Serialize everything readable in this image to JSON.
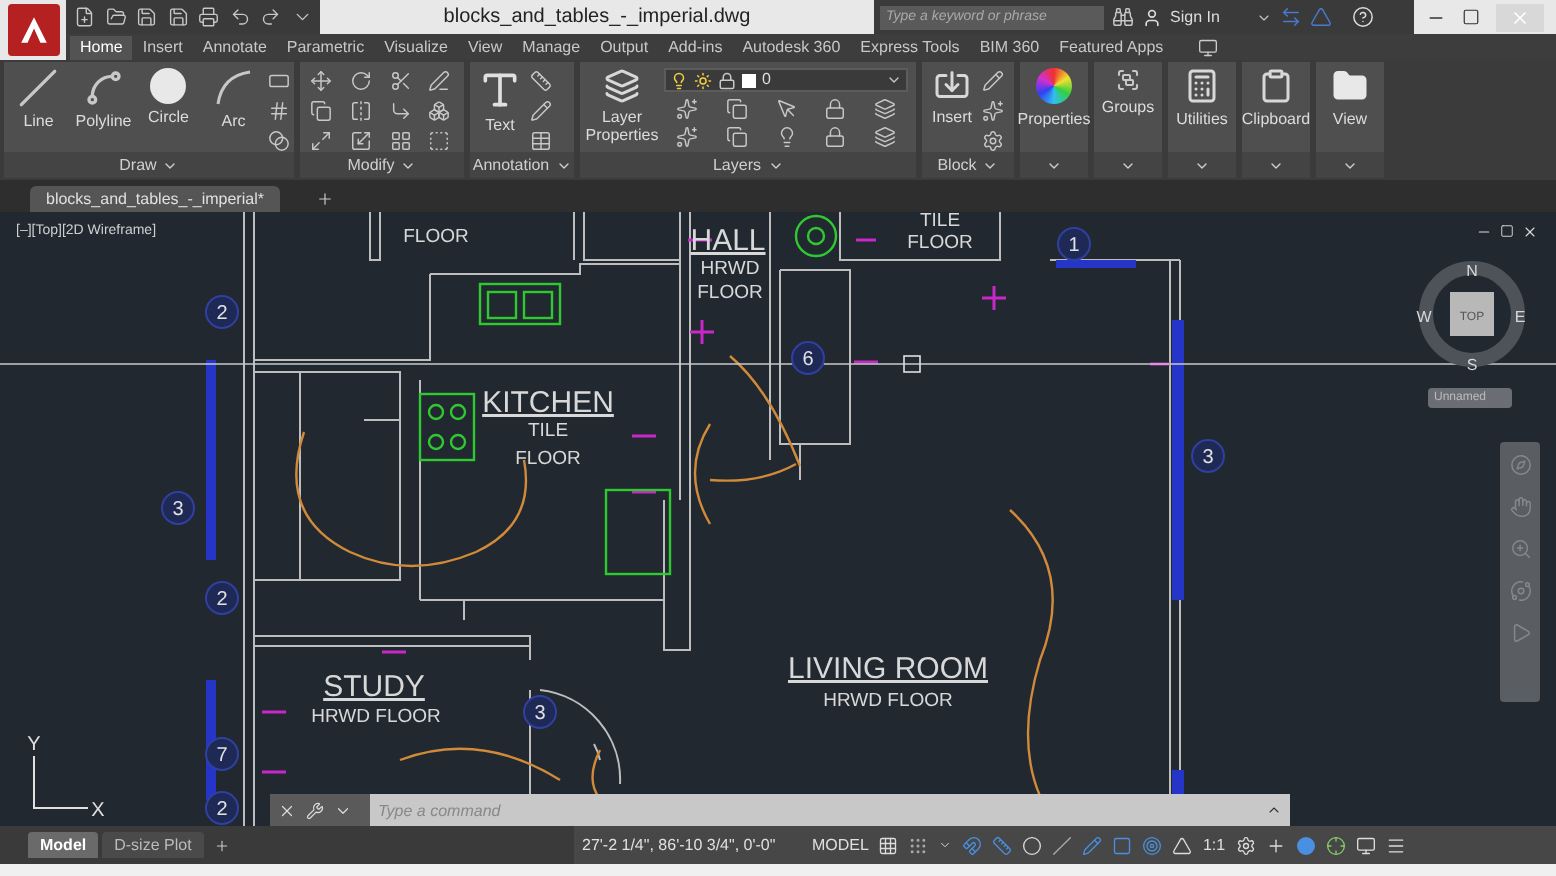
{
  "title_bar": {
    "title": "blocks_and_tables_-_imperial.dwg",
    "search": {
      "placeholder": "Type a keyword or phrase"
    },
    "sign_in": "Sign In"
  },
  "ribbon_tabs": [
    {
      "label": "Home",
      "selected": true
    },
    {
      "label": "Insert",
      "selected": false
    },
    {
      "label": "Annotate",
      "selected": false
    },
    {
      "label": "Parametric",
      "selected": false
    },
    {
      "label": "Visualize",
      "selected": false
    },
    {
      "label": "View",
      "selected": false
    },
    {
      "label": "Manage",
      "selected": false
    },
    {
      "label": "Output",
      "selected": false
    },
    {
      "label": "Add-ins",
      "selected": false
    },
    {
      "label": "Autodesk 360",
      "selected": false
    },
    {
      "label": "Express Tools",
      "selected": false
    },
    {
      "label": "BIM 360",
      "selected": false
    },
    {
      "label": "Featured Apps",
      "selected": false
    }
  ],
  "panels": [
    {
      "title": "Draw",
      "kind": "draw",
      "tools": [
        "Line",
        "Polyline",
        "Circle",
        "Arc"
      ]
    },
    {
      "title": "Modify",
      "kind": "modify"
    },
    {
      "title": "Annotation",
      "kind": "annotation",
      "tools": [
        "Text"
      ]
    },
    {
      "title": "Layers",
      "kind": "layers",
      "tools": [
        "Layer Properties"
      ],
      "layer": "0"
    },
    {
      "title": "Block",
      "kind": "block",
      "tools": [
        "Insert"
      ]
    },
    {
      "title": "Properties",
      "kind": "collapsed"
    },
    {
      "title": "Groups",
      "kind": "collapsed"
    },
    {
      "title": "Utilities",
      "kind": "collapsed"
    },
    {
      "title": "Clipboard",
      "kind": "collapsed"
    },
    {
      "title": "View",
      "kind": "collapsed"
    }
  ],
  "document_tabs": [
    {
      "label": "blocks_and_tables_-_imperial*",
      "selected": true
    }
  ],
  "viewport": {
    "label": "[–][Top][2D Wireframe]",
    "room_labels": [
      {
        "text": "FLOOR",
        "kind": "note"
      },
      {
        "text": "HALL",
        "kind": "title"
      },
      {
        "text": "HRWD",
        "kind": "note"
      },
      {
        "text": "FLOOR",
        "kind": "note"
      },
      {
        "text": "TILE",
        "kind": "note"
      },
      {
        "text": "FLOOR",
        "kind": "note"
      },
      {
        "text": "KITCHEN",
        "kind": "title"
      },
      {
        "text": "TILE",
        "kind": "note"
      },
      {
        "text": "FLOOR",
        "kind": "note"
      },
      {
        "text": "STUDY",
        "kind": "title"
      },
      {
        "text": "HRWD  FLOOR",
        "kind": "note"
      },
      {
        "text": "LIVING  ROOM",
        "kind": "title"
      },
      {
        "text": "HRWD  FLOOR",
        "kind": "note"
      }
    ],
    "tags": [
      "1",
      "2",
      "6",
      "3",
      "3",
      "2",
      "3",
      "7",
      "2"
    ],
    "compass": {
      "n": "N",
      "e": "E",
      "s": "S",
      "w": "W",
      "face": "TOP"
    },
    "ucs_menu": "Unnamed",
    "ucs_axes": {
      "x": "X",
      "y": "Y"
    }
  },
  "command_line": {
    "placeholder": "Type a command"
  },
  "layout_tabs": [
    {
      "label": "Model",
      "selected": true
    },
    {
      "label": "D-size Plot",
      "selected": false
    }
  ],
  "status_bar": {
    "coordinates": "27'-2 1/4\", 86'-10 3/4\", 0'-0\"",
    "space": "MODEL",
    "scale": "1:1"
  }
}
